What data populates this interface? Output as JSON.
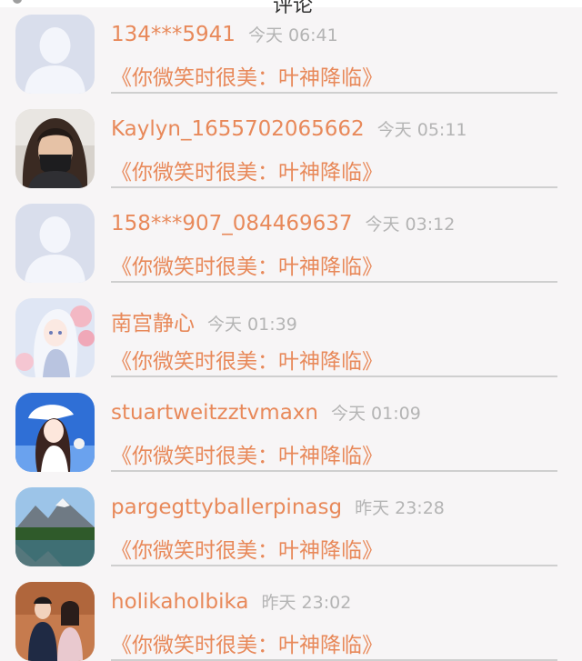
{
  "header": {
    "title_fragment": "评论"
  },
  "comments": [
    {
      "username": "134***5941",
      "time": "今天 06:41",
      "work_title": "《你微笑时很美：叶神降临》",
      "avatar": "default-avatar-icon"
    },
    {
      "username": "Kaylyn_1655702065662",
      "time": "今天 05:11",
      "work_title": "《你微笑时很美：叶神降临》",
      "avatar": "user-photo-avatar"
    },
    {
      "username": "158***907_084469637",
      "time": "今天 03:12",
      "work_title": "《你微笑时很美：叶神降临》",
      "avatar": "default-avatar-icon"
    },
    {
      "username": "南宫静心",
      "time": "今天 01:39",
      "work_title": "《你微笑时很美：叶神降临》",
      "avatar": "anime-girl-avatar"
    },
    {
      "username": "stuartweitzztvmaxn",
      "time": "今天 01:09",
      "work_title": "《你微笑时很美：叶神降临》",
      "avatar": "anime-girl-blue-sky-avatar"
    },
    {
      "username": "pargegttyballerpinasg",
      "time": "昨天 23:28",
      "work_title": "《你微笑时很美：叶神降临》",
      "avatar": "mountain-lake-avatar"
    },
    {
      "username": "holikaholbika",
      "time": "昨天 23:02",
      "work_title": "《你微笑时很美：叶神降临》",
      "avatar": "couple-photo-avatar"
    }
  ],
  "colors": {
    "accent": "#e8895a",
    "time": "#b4b4b4",
    "divider": "#cfcfcf",
    "background": "#f7f5f6"
  }
}
